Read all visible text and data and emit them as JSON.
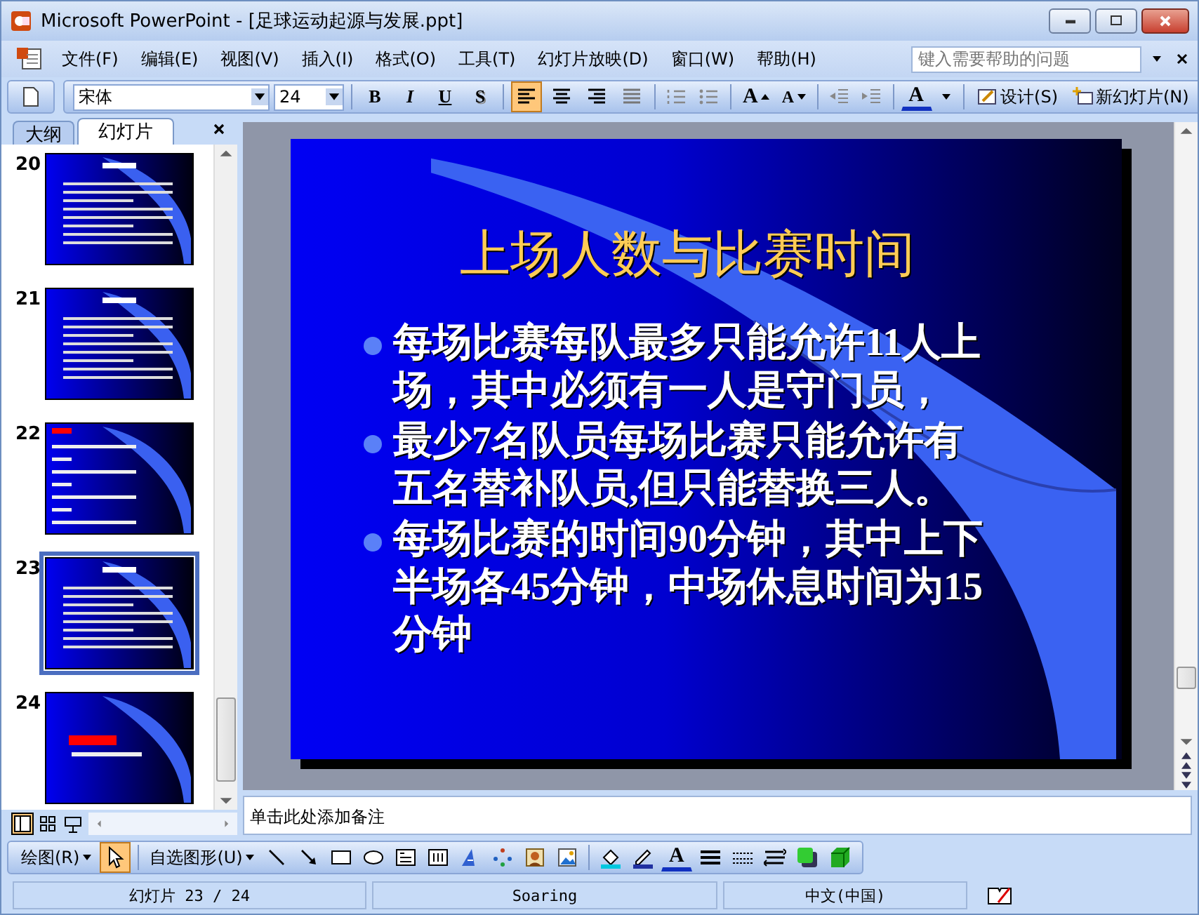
{
  "window": {
    "title": "Microsoft PowerPoint - [足球运动起源与发展.ppt]"
  },
  "menu": [
    {
      "label": "文件(F)"
    },
    {
      "label": "编辑(E)"
    },
    {
      "label": "视图(V)"
    },
    {
      "label": "插入(I)"
    },
    {
      "label": "格式(O)"
    },
    {
      "label": "工具(T)"
    },
    {
      "label": "幻灯片放映(D)"
    },
    {
      "label": "窗口(W)"
    },
    {
      "label": "帮助(H)"
    }
  ],
  "help_search": {
    "placeholder": "键入需要帮助的问题"
  },
  "format_toolbar": {
    "font": "宋体",
    "size": "24",
    "styles": [
      {
        "label": "B",
        "kind": "bold"
      },
      {
        "label": "I",
        "kind": "italic"
      },
      {
        "label": "U",
        "kind": "underline"
      },
      {
        "label": "S",
        "kind": "shadow"
      }
    ],
    "alignment": [
      {
        "kind": "left",
        "selected": true
      },
      {
        "kind": "center",
        "selected": false
      },
      {
        "kind": "right",
        "selected": false
      },
      {
        "kind": "justify",
        "selected": false
      }
    ],
    "grow_label": "A",
    "shrink_label": "A",
    "font_color_label": "A",
    "design": "设计(S)",
    "new_slide": "新幻灯片(N)"
  },
  "pane_tabs": [
    {
      "label": "大纲",
      "selected": false
    },
    {
      "label": "幻灯片",
      "selected": true
    }
  ],
  "thumbnails": [
    {
      "number": "20",
      "kind": "text",
      "selected": false
    },
    {
      "number": "21",
      "kind": "text",
      "selected": false
    },
    {
      "number": "22",
      "kind": "list",
      "selected": false
    },
    {
      "number": "23",
      "kind": "text",
      "selected": true
    },
    {
      "number": "24",
      "kind": "title",
      "selected": false
    }
  ],
  "slide": {
    "title": "上场人数与比赛时间",
    "bullets": [
      "每场比赛每队最多只能允许11人上场，其中必须有一人是守门员，",
      "最少7名队员每场比赛只能允许有五名替补队员,但只能替换三人。",
      "每场比赛的时间90分钟，其中上下半场各45分钟，中场休息时间为15分钟"
    ]
  },
  "notes": {
    "placeholder": "单击此处添加备注"
  },
  "drawing_toolbar": {
    "draw_menu": "绘图(R)",
    "autoshapes": "自选图形(U)",
    "select_selected": true,
    "font_color_label": "A"
  },
  "status_bar": [
    "幻灯片 23 / 24",
    "Soaring",
    "中文(中国)"
  ]
}
